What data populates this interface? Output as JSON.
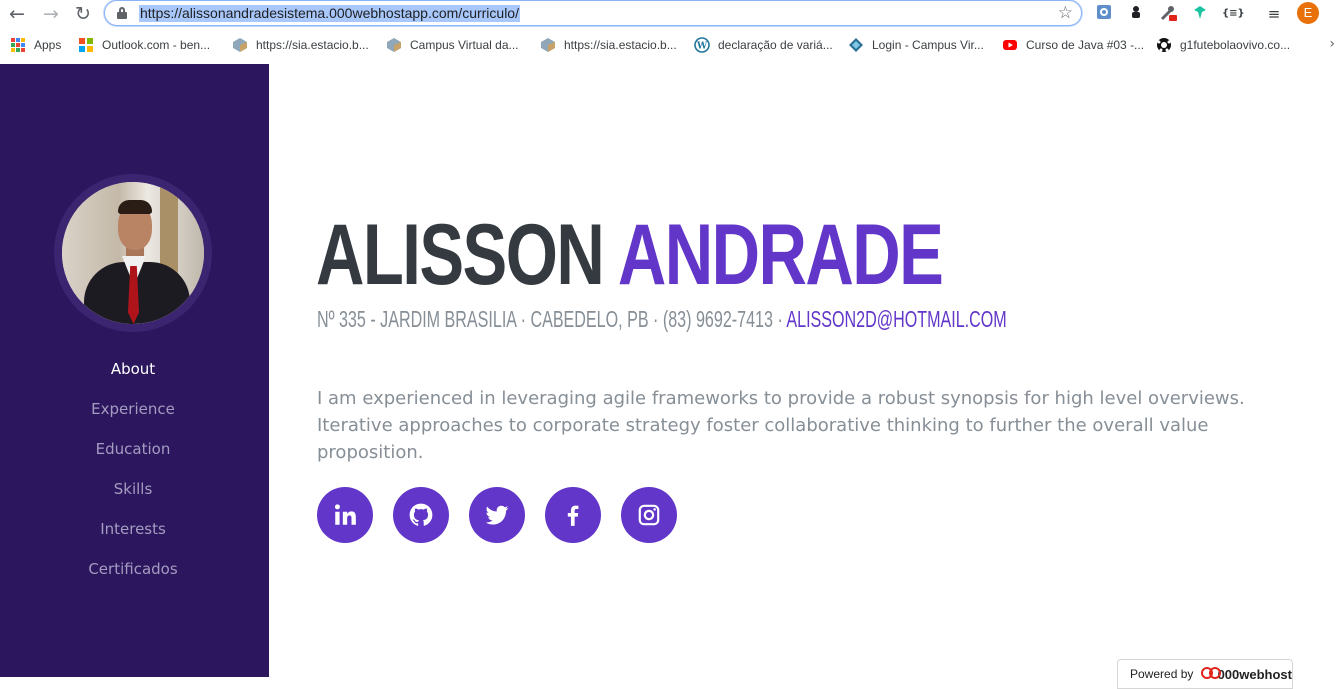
{
  "browser": {
    "url": "https://alissonandradesistema.000webhostapp.com/curriculo/",
    "profile_initial": "E",
    "bookmarks": [
      {
        "label": "Apps"
      },
      {
        "label": "Outlook.com - ben..."
      },
      {
        "label": "https://sia.estacio.b..."
      },
      {
        "label": "Campus Virtual da..."
      },
      {
        "label": "https://sia.estacio.b..."
      },
      {
        "label": "declaração de variá..."
      },
      {
        "label": "Login - Campus Vir..."
      },
      {
        "label": "Curso de Java #03 -..."
      },
      {
        "label": "g1futebolaovivo.co..."
      }
    ]
  },
  "sidebar": {
    "nav": [
      {
        "label": "About"
      },
      {
        "label": "Experience"
      },
      {
        "label": "Education"
      },
      {
        "label": "Skills"
      },
      {
        "label": "Interests"
      },
      {
        "label": "Certificados"
      }
    ]
  },
  "about": {
    "first_name": "ALISSON",
    "last_name": "ANDRADE",
    "address": "Nº 335 - JARDIM BRASILIA · CABEDELO, PB · (83) 9692-7413 ·",
    "email": "ALISSON2D@HOTMAIL.COM",
    "lead": "I am experienced in leveraging agile frameworks to provide a robust synopsis for high level overviews. Iterative approaches to corporate strategy foster collaborative thinking to further the overall value proposition."
  },
  "socials": [
    {
      "icon": "linkedin-icon"
    },
    {
      "icon": "github-icon"
    },
    {
      "icon": "twitter-icon"
    },
    {
      "icon": "facebook-icon"
    },
    {
      "icon": "instagram-icon"
    }
  ],
  "footer": {
    "powered_by": "Powered by",
    "brand": "000webhost"
  },
  "colors": {
    "sidebar": "#2c175f",
    "accent": "#6236c9",
    "heading": "#343a40",
    "muted": "#868e96"
  }
}
